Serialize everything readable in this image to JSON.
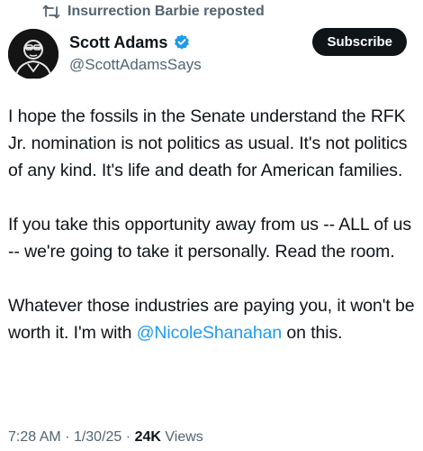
{
  "repost": {
    "text": "Insurrection Barbie reposted",
    "icon": "repost-icon"
  },
  "author": {
    "display_name": "Scott Adams",
    "handle": "@ScottAdamsSays",
    "verified": true,
    "verified_color": "#1d9bf0"
  },
  "subscribe_label": "Subscribe",
  "tweet": {
    "paragraph1": "I hope the fossils in the Senate understand the RFK Jr. nomination is not politics as usual. It's not politics of any kind. It's life and death for American families.",
    "paragraph2": "If you take this opportunity away from us -- ALL of us -- we're going to take it personally. Read the room.",
    "paragraph3_before": "Whatever those industries are paying you, it won't be worth it. I'm with ",
    "mention": "@NicoleShanahan",
    "paragraph3_after": " on this."
  },
  "meta": {
    "time": "7:28 AM",
    "separator": "·",
    "date": "1/30/25",
    "views_count": "24K",
    "views_label": "Views"
  },
  "colors": {
    "text": "#0f1419",
    "secondary": "#536471",
    "link": "#1d9bf0",
    "button_bg": "#0f1419"
  }
}
